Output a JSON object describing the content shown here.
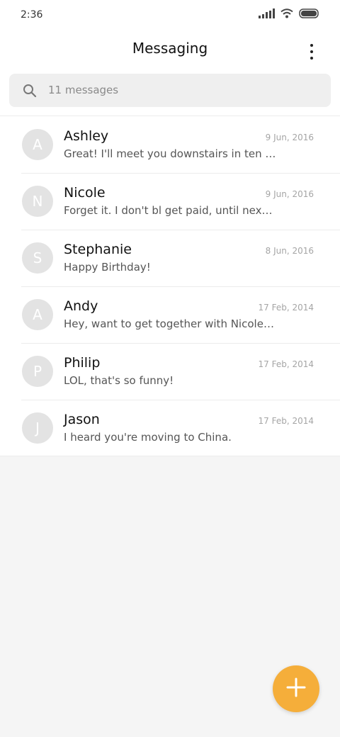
{
  "status_bar": {
    "time": "2:36",
    "icons": [
      "signal-icon",
      "wifi-icon",
      "battery-icon"
    ]
  },
  "header": {
    "title": "Messaging",
    "more_icon": "more-vertical-icon"
  },
  "search": {
    "text": "11 messages",
    "icon": "search-icon"
  },
  "conversations": [
    {
      "initial": "A",
      "name": "Ashley",
      "date": "9 Jun, 2016",
      "preview": "Great! I'll meet you downstairs in ten minutes"
    },
    {
      "initial": "N",
      "name": "Nicole",
      "date": "9 Jun, 2016",
      "preview": "Forget it. I don't bl get paid, until next week"
    },
    {
      "initial": "S",
      "name": "Stephanie",
      "date": "8 Jun, 2016",
      "preview": "Happy Birthday!"
    },
    {
      "initial": "A",
      "name": "Andy",
      "date": "17 Feb, 2014",
      "preview": "Hey, want to get together with Nicole on Friday?"
    },
    {
      "initial": "P",
      "name": "Philip",
      "date": "17 Feb, 2014",
      "preview": "LOL, that's so funny!"
    },
    {
      "initial": "J",
      "name": "Jason",
      "date": "17 Feb, 2014",
      "preview": "I heard you're moving to China."
    }
  ],
  "fab": {
    "icon": "plus-icon",
    "color": "#f5ae3a"
  },
  "colors": {
    "background": "#f5f5f5",
    "avatar": "#e3e3e3",
    "accent": "#f5ae3a"
  }
}
